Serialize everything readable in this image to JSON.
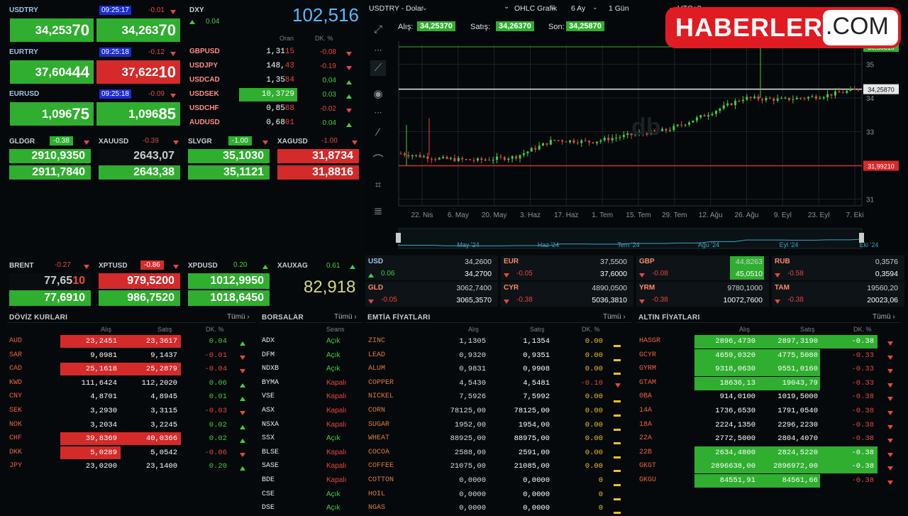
{
  "fx_tiles": [
    {
      "name": "USDTRY",
      "time": "09:25:17",
      "change": "-0.01",
      "bid": "34,253",
      "bid_hi": "70",
      "ask": "34,263",
      "ask_hi": "70",
      "bid_color": "g",
      "ask_color": "g"
    },
    {
      "name": "EURTRY",
      "time": "09:25:18",
      "change": "-0.12",
      "bid": "37,604",
      "bid_hi": "44",
      "ask": "37,622",
      "ask_hi": "10",
      "bid_color": "g",
      "ask_color": "r"
    },
    {
      "name": "EURUSD",
      "time": "09:25:18",
      "change": "-0.09",
      "bid": "1,096",
      "bid_hi": "75",
      "ask": "1,096",
      "ask_hi": "85",
      "bid_color": "g",
      "ask_color": "g"
    }
  ],
  "dxy": {
    "name": "DXY",
    "value": "102,516",
    "change": "0.04",
    "col_oran": "Oran",
    "col_dk": "DK. %",
    "rows": [
      {
        "code": "GBPUSD",
        "val": "1,31",
        "val_hi": "15",
        "chg": "-0.08",
        "dir": "dn"
      },
      {
        "code": "USDJPY",
        "val": "148,",
        "val_hi": "43",
        "chg": "-0.19",
        "dir": "dn"
      },
      {
        "code": "USDCAD",
        "val": "1,35",
        "val_hi": "84",
        "chg": "0.04",
        "dir": "up"
      },
      {
        "code": "USDSEK",
        "val": "10,3729",
        "val_hi": "",
        "chg": "0.03",
        "dir": "up",
        "box": true
      },
      {
        "code": "USDCHF",
        "val": "0,85",
        "val_hi": "88",
        "chg": "-0.02",
        "dir": "dn"
      },
      {
        "code": "AUDUSD",
        "val": "0,68",
        "val_hi": "01",
        "chg": "0.04",
        "dir": "up"
      }
    ]
  },
  "metals_top": [
    {
      "name": "GLDGR",
      "chg": "-0.38",
      "v1": "2910,9350",
      "v2": "2911,7840",
      "c1": "g",
      "c2": "g"
    },
    {
      "name": "XAUUSD",
      "chg": "-0.39",
      "v1": "2643,07",
      "v2": "2643,38",
      "c1": "k",
      "c2": "g"
    },
    {
      "name": "SLVGR",
      "chg": "-1.00",
      "v1": "35,1030",
      "v2": "35,1121",
      "c1": "g",
      "c2": "g"
    },
    {
      "name": "XAGUSD",
      "chg": "-1.00",
      "v1": "31,8734",
      "v2": "31,8816",
      "c1": "r",
      "c2": "r"
    }
  ],
  "metals_bottom": [
    {
      "name": "BRENT",
      "chg": "-0.27",
      "v1": "77,65",
      "v1_hi": "10",
      "v2": "77,6910",
      "c1": "k",
      "c2": "g"
    },
    {
      "name": "XPTUSD",
      "chg": "-0.86",
      "v1": "979,5200",
      "v1_hi": "",
      "v2": "986,7520",
      "c1": "r",
      "c2": "g"
    },
    {
      "name": "XPDUSD",
      "chg": "0.20",
      "v1": "1012,9950",
      "v1_hi": "",
      "v2": "1018,6450",
      "c1": "g",
      "c2": "g"
    }
  ],
  "xauxag": {
    "name": "XAUXAG",
    "chg": "0.61",
    "value": "82,918"
  },
  "chart": {
    "symbol": "USDTRY - Dolar",
    "type": "OHLC Grafik",
    "range": "6 Ay",
    "interval": "1 Gün",
    "extra": "UTC+3",
    "alis_label": "Alış:",
    "alis": "34,25370",
    "satis_label": "Satış:",
    "satis": "34,26370",
    "son_label": "Son:",
    "son": "34,25870",
    "price_tag": "34,25870",
    "low_tag": "31,99210",
    "top_tag": "35,50810",
    "x_labels": [
      "22. Nis",
      "6. May",
      "20. May",
      "3. Haz",
      "17. Haz",
      "1. Tem",
      "15. Tem",
      "29. Tem",
      "12. Ağu",
      "26. Ağu",
      "9. Eyl",
      "23. Eyl",
      "7. Eki"
    ],
    "y_labels": [
      "35",
      "34",
      "33",
      "32",
      "31"
    ],
    "nav_labels": [
      "May '24",
      "Haz '24",
      "Tem '24",
      "Ağu '24",
      "Eyl '24",
      "Eki '24"
    ]
  },
  "chart_data": {
    "type": "line",
    "title": "USDTRY - Dolar",
    "ylim": [
      30.8,
      35.6
    ],
    "x": [
      "22. Nis",
      "6. May",
      "20. May",
      "3. Haz",
      "17. Haz",
      "1. Tem",
      "15. Tem",
      "29. Tem",
      "12. Ağu",
      "26. Ağu",
      "9. Eyl",
      "23. Eyl",
      "7. Eki"
    ],
    "series": [
      {
        "values": [
          32.35,
          32.2,
          32.15,
          32.25,
          32.75,
          32.7,
          32.9,
          33.05,
          33.5,
          34.0,
          33.95,
          34.05,
          34.26
        ]
      }
    ]
  },
  "mid_quotes": [
    {
      "code": "USD",
      "v1": "34,2600",
      "v2": "34,2700",
      "chg": "0.06",
      "dir": "up"
    },
    {
      "code": "EUR",
      "v1": "37,5500",
      "v2": "37,6000",
      "chg": "-0.05",
      "dir": "dn"
    },
    {
      "code": "GBP",
      "v1": "44,8263",
      "v2": "45,0510",
      "chg": "-0.08",
      "dir": "dn",
      "box": true
    },
    {
      "code": "RUB",
      "v1": "0,3576",
      "v2": "0,3594",
      "chg": "-0.58",
      "dir": "dn"
    },
    {
      "code": "GLD",
      "v1": "3062,7400",
      "v2": "3065,3570",
      "chg": "-0.05",
      "dir": "dn"
    },
    {
      "code": "CYR",
      "v1": "4890,0500",
      "v2": "5036,3810",
      "chg": "-0.38",
      "dir": "dn"
    },
    {
      "code": "YRM",
      "v1": "9780,1000",
      "v2": "10072,7600",
      "chg": "-0.38",
      "dir": "dn"
    },
    {
      "code": "TAM",
      "v1": "19560,20",
      "v2": "20023,06",
      "chg": "-0.38",
      "dir": "dn"
    }
  ],
  "doviz": {
    "title": "DÖVİZ KURLARI",
    "more": "Tümü ›",
    "h_alis": "Alış",
    "h_satis": "Satış",
    "h_dk": "DK. %",
    "rows": [
      {
        "c": "AUD",
        "a": "23,2451",
        "s": "23,3617",
        "d": "0.04",
        "dir": "up",
        "box": "r"
      },
      {
        "c": "SAR",
        "a": "9,0981",
        "s": "9,1437",
        "d": "-0.01",
        "dir": "dn"
      },
      {
        "c": "CAD",
        "a": "25,1618",
        "s": "25,2879",
        "d": "-0.04",
        "dir": "dn",
        "box": "r"
      },
      {
        "c": "KWD",
        "a": "111,6424",
        "s": "112,2020",
        "d": "0.06",
        "dir": "up"
      },
      {
        "c": "CNY",
        "a": "4,8701",
        "s": "4,8945",
        "d": "0.01",
        "dir": "up"
      },
      {
        "c": "SEK",
        "a": "3,2930",
        "s": "3,3115",
        "d": "-0.03",
        "dir": "dn"
      },
      {
        "c": "NOK",
        "a": "3,2034",
        "s": "3,2245",
        "d": "0.02",
        "dir": "up"
      },
      {
        "c": "CHF",
        "a": "39,8369",
        "s": "40,0366",
        "d": "0.02",
        "dir": "up",
        "box": "r"
      },
      {
        "c": "DKK",
        "a": "5,0289",
        "s": "5,0542",
        "d": "-0.06",
        "dir": "dn",
        "box": "ra"
      },
      {
        "c": "JPY",
        "a": "23,0200",
        "s": "23,1400",
        "d": "0.20",
        "dir": "up"
      }
    ]
  },
  "borsalar": {
    "title": "BORSALAR",
    "more": "Tümü ›",
    "h_seans": "Seans",
    "rows": [
      {
        "c": "ADX",
        "s": "Açık",
        "o": true
      },
      {
        "c": "DFM",
        "s": "Açık",
        "o": true
      },
      {
        "c": "NDXB",
        "s": "Açık",
        "o": true
      },
      {
        "c": "BYMA",
        "s": "Kapalı",
        "o": false
      },
      {
        "c": "VSE",
        "s": "Kapalı",
        "o": false
      },
      {
        "c": "ASX",
        "s": "Kapalı",
        "o": false
      },
      {
        "c": "NSXA",
        "s": "Kapalı",
        "o": false
      },
      {
        "c": "SSX",
        "s": "Açık",
        "o": true
      },
      {
        "c": "BLSE",
        "s": "Kapalı",
        "o": false
      },
      {
        "c": "SASE",
        "s": "Kapalı",
        "o": false
      },
      {
        "c": "BDE",
        "s": "Kapalı",
        "o": false
      },
      {
        "c": "CSE",
        "s": "Açık",
        "o": true
      },
      {
        "c": "DSE",
        "s": "Açık",
        "o": true
      }
    ]
  },
  "emtia": {
    "title": "EMTİA FİYATLARI",
    "more": "Tümü ›",
    "h_alis": "Alış",
    "h_satis": "Satış",
    "h_dk": "DK. %",
    "rows": [
      {
        "c": "ZINC",
        "a": "1,1305",
        "s": "1,1354",
        "d": "0.00"
      },
      {
        "c": "LEAD",
        "a": "0,9320",
        "s": "0,9351",
        "d": "0.00"
      },
      {
        "c": "ALUM",
        "a": "0,9831",
        "s": "0,9908",
        "d": "0.00"
      },
      {
        "c": "COPPER",
        "a": "4,5430",
        "s": "4,5481",
        "d": "-0.10",
        "dir": "dn"
      },
      {
        "c": "NICKEL",
        "a": "7,5926",
        "s": "7,5992",
        "d": "0.00"
      },
      {
        "c": "CORN",
        "a": "78125,00",
        "s": "78125,00",
        "d": "0.00"
      },
      {
        "c": "SUGAR",
        "a": "1952,00",
        "s": "1954,00",
        "d": "0.00"
      },
      {
        "c": "WHEAT",
        "a": "88925,00",
        "s": "88975,00",
        "d": "0.00"
      },
      {
        "c": "COCOA",
        "a": "2588,00",
        "s": "2591,00",
        "d": "0.00"
      },
      {
        "c": "COFFEE",
        "a": "21075,00",
        "s": "21085,00",
        "d": "0.00"
      },
      {
        "c": "COTTON",
        "a": "0,0000",
        "s": "0,0000",
        "d": "0"
      },
      {
        "c": "HOIL",
        "a": "0,0000",
        "s": "0,0000",
        "d": "0"
      },
      {
        "c": "NGAS",
        "a": "0,0000",
        "s": "0,0000",
        "d": "0"
      }
    ]
  },
  "altin": {
    "title": "ALTIN FİYATLARI",
    "more": "Tümü ›",
    "h_alis": "Alış",
    "h_satis": "Satış",
    "h_dk": "DK. %",
    "rows": [
      {
        "c": "HASGR",
        "a": "2896,4730",
        "s": "2897,3190",
        "d": "-0.38",
        "box": true
      },
      {
        "c": "GCYR",
        "a": "4659,0320",
        "s": "4775,5080",
        "d": "-0.33",
        "box": true
      },
      {
        "c": "GYRM",
        "a": "9318,0630",
        "s": "9551,0160",
        "d": "-0.33",
        "box": true
      },
      {
        "c": "GTAM",
        "a": "18636,13",
        "s": "19043,79",
        "d": "-0.33",
        "box": true
      },
      {
        "c": "0BA",
        "a": "914,0100",
        "s": "1019,5000",
        "d": "-0.38"
      },
      {
        "c": "14A",
        "a": "1736,6530",
        "s": "1791,0540",
        "d": "-0.38"
      },
      {
        "c": "18A",
        "a": "2224,1350",
        "s": "2296,2230",
        "d": "-0.38"
      },
      {
        "c": "22A",
        "a": "2772,5000",
        "s": "2804,4070",
        "d": "-0.38"
      },
      {
        "c": "22B",
        "a": "2634,4800",
        "s": "2824,5220",
        "d": "-0.38",
        "box": true
      },
      {
        "c": "GKGT",
        "a": "2896638,00",
        "s": "2896972,00",
        "d": "-0.38",
        "box": true
      },
      {
        "c": "GKGU",
        "a": "84551,91",
        "s": "84561,66",
        "d": "-0.38",
        "box": true
      }
    ]
  },
  "logo": {
    "brand": "HABERLER",
    "tld": ".COM"
  }
}
